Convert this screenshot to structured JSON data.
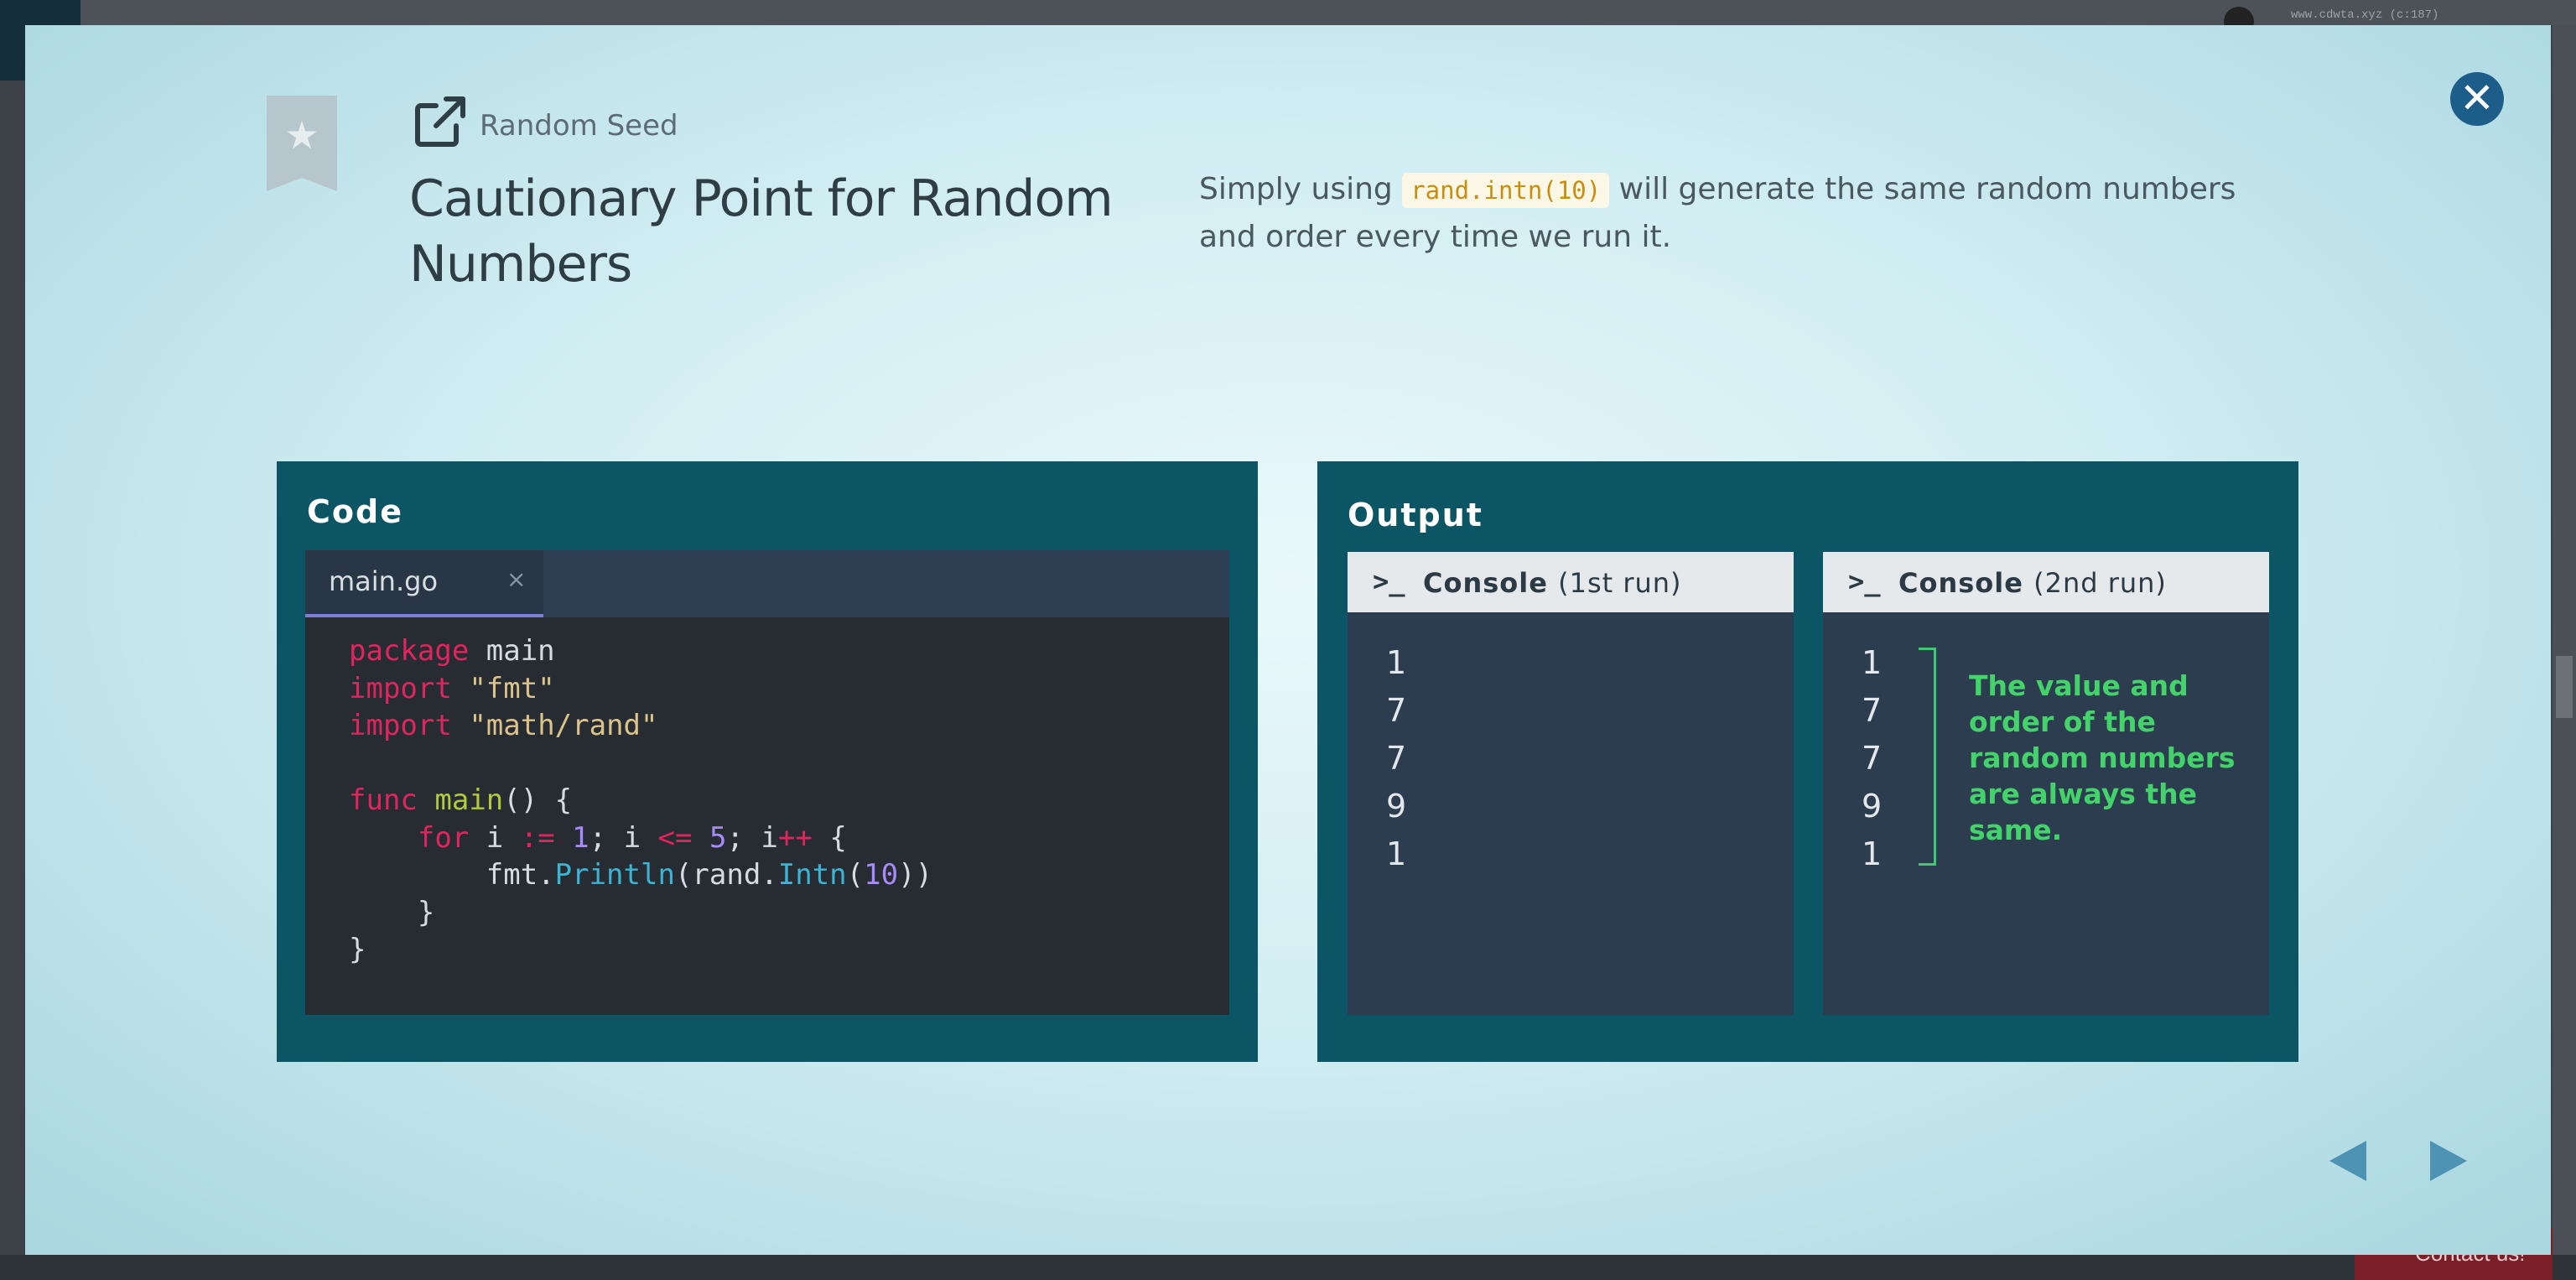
{
  "page": {
    "url_text": "www.cdwta.xyz (c:187)",
    "contact_label": "Contact us!"
  },
  "modal": {
    "subtitle": "Random Seed",
    "title": "Cautionary Point for Random Numbers",
    "description": {
      "before": "Simply using ",
      "code": "rand.intn(10)",
      "after": " will generate the same random numbers and order every time we run it."
    },
    "close_icon": "close-icon",
    "bookmark_icon": "star-icon",
    "external_icon": "external-link-icon"
  },
  "code_panel": {
    "title": "Code",
    "tab_label": "main.go",
    "tab_close": "×",
    "lines": [
      "package main",
      "import \"fmt\"",
      "import \"math/rand\"",
      "",
      "func main() {",
      "    for i := 1; i <= 5; i++ {",
      "        fmt.Println(rand.Intn(10))",
      "    }",
      "}"
    ]
  },
  "output_panel": {
    "title": "Output",
    "consoles": [
      {
        "prompt": ">_",
        "label": "Console",
        "run": "(1st run)",
        "values": [
          "1",
          "7",
          "7",
          "9",
          "1"
        ]
      },
      {
        "prompt": ">_",
        "label": "Console",
        "run": "(2nd run)",
        "values": [
          "1",
          "7",
          "7",
          "9",
          "1"
        ]
      }
    ],
    "note": "The value and order of the random numbers are always the same."
  },
  "nav": {
    "prev_icon": "triangle-left-icon",
    "next_icon": "triangle-right-icon"
  },
  "colors": {
    "panel_bg": "#0c5565",
    "editor_bg": "#272c33",
    "keyword": "#e0245e",
    "string": "#dcc389",
    "function": "#b4c93c",
    "number": "#a78bfa",
    "method": "#3bb5d3",
    "note": "#44d36a",
    "nav_arrow": "#4e92b4",
    "close_button": "#1c5d8a"
  }
}
